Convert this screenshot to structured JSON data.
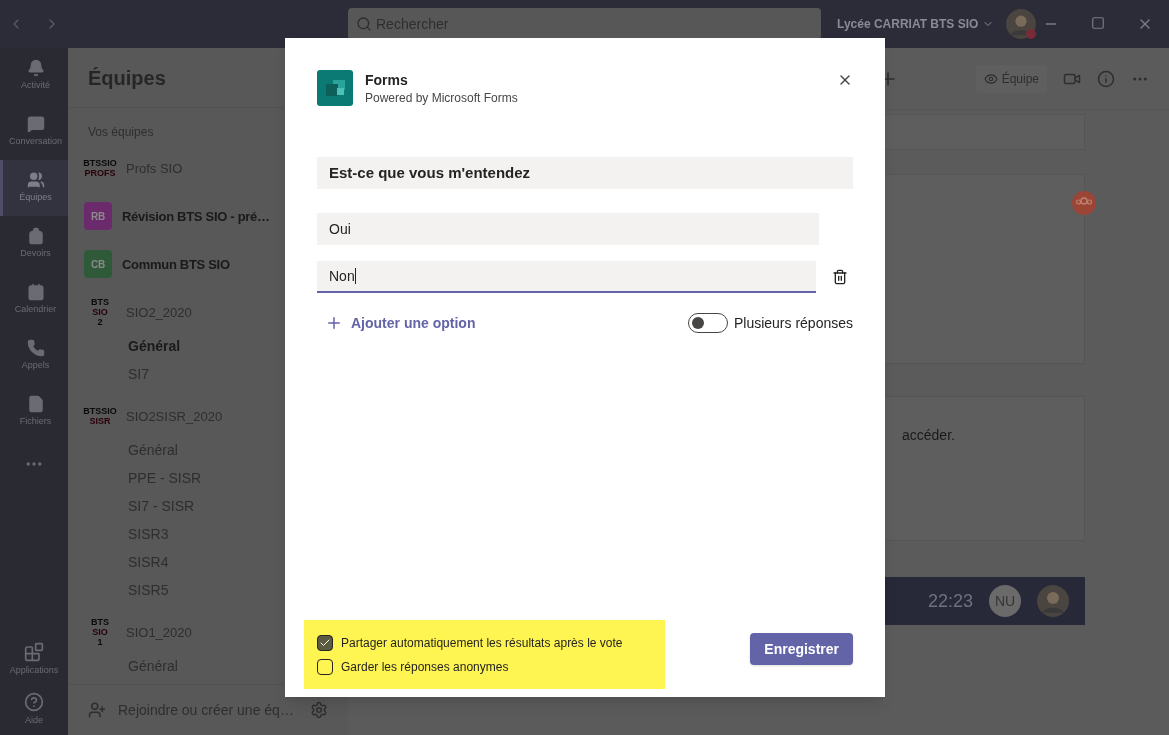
{
  "titlebar": {
    "search_placeholder": "Rechercher",
    "org": "Lycée CARRIAT BTS SIO"
  },
  "rail": [
    {
      "label": "Activité",
      "selected": false
    },
    {
      "label": "Conversation",
      "selected": false
    },
    {
      "label": "Équipes",
      "selected": true
    },
    {
      "label": "Devoirs",
      "selected": false
    },
    {
      "label": "Calendrier",
      "selected": false
    },
    {
      "label": "Appels",
      "selected": false
    },
    {
      "label": "Fichiers",
      "selected": false
    }
  ],
  "rail_bottom": [
    {
      "label": "Applications"
    },
    {
      "label": "Aide"
    }
  ],
  "teams_panel": {
    "title": "Équipes",
    "section": "Vos équipes",
    "footer": "Rejoindre ou créer une éq…",
    "teams": [
      {
        "name": "Profs SIO",
        "bold": false,
        "avatar": {
          "kind": "logo",
          "lines": [
            "BTSSIO",
            "PROFS"
          ]
        }
      },
      {
        "name": "Révision BTS SIO - pré…",
        "bold": true,
        "avatar": {
          "kind": "initials",
          "text": "RB",
          "color": "#6b2a6b"
        }
      },
      {
        "name": "Commun BTS SIO",
        "bold": true,
        "avatar": {
          "kind": "initials",
          "text": "CB",
          "color": "#2f5a3a"
        }
      },
      {
        "name": "SIO2_2020",
        "bold": false,
        "avatar": {
          "kind": "logo",
          "lines": [
            "BTS",
            "SIO",
            "2"
          ]
        },
        "channels": [
          {
            "name": "Général",
            "bold": true
          },
          {
            "name": "SI7",
            "bold": false
          }
        ]
      },
      {
        "name": "SIO2SISR_2020",
        "bold": false,
        "avatar": {
          "kind": "logo",
          "lines": [
            "BTSSIO",
            "SISR"
          ]
        },
        "channels": [
          {
            "name": "Général",
            "bold": false
          },
          {
            "name": "PPE - SISR",
            "bold": false
          },
          {
            "name": "SI7 - SISR",
            "bold": false
          },
          {
            "name": "SISR3",
            "bold": false
          },
          {
            "name": "SISR4",
            "bold": false
          },
          {
            "name": "SISR5",
            "bold": false
          }
        ]
      },
      {
        "name": "SIO1_2020",
        "bold": false,
        "avatar": {
          "kind": "logo",
          "lines": [
            "BTS",
            "SIO",
            "1"
          ]
        },
        "channels": [
          {
            "name": "Général",
            "bold": false
          }
        ]
      }
    ]
  },
  "channel_header": {
    "team_button": "Équipe"
  },
  "conversation": {
    "text": "accéder.",
    "time": "22:23",
    "initials": "NU"
  },
  "dialog": {
    "app_name": "Forms",
    "subtitle": "Powered by Microsoft Forms",
    "question": "Est-ce que vous m'entendez",
    "options": [
      {
        "value": "Oui",
        "focused": false
      },
      {
        "value": "Non",
        "focused": true
      }
    ],
    "add_option": "Ajouter une option",
    "multiple": {
      "label": "Plusieurs réponses",
      "on": false
    },
    "settings": [
      {
        "label": "Partager automatiquement les résultats après le vote",
        "checked": true
      },
      {
        "label": "Garder les réponses anonymes",
        "checked": false
      }
    ],
    "save": "Enregistrer"
  }
}
